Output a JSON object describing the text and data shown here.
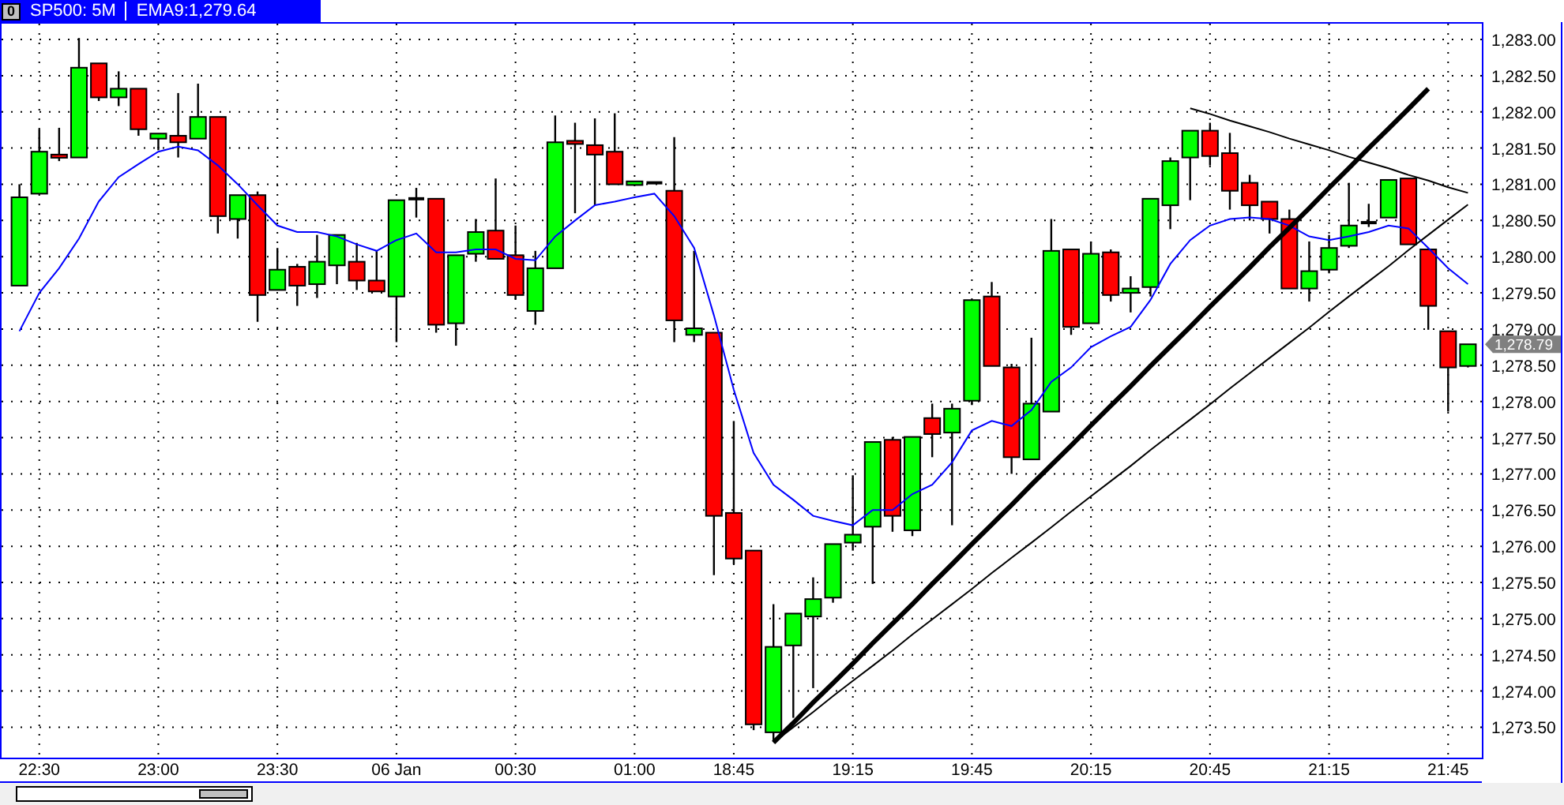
{
  "header": {
    "menu_glyph": "0",
    "symbol": "SP500: 5M",
    "indicator": "EMA9:1,279.64"
  },
  "chart": {
    "last_price_label": "1,278.79",
    "chart_data": {
      "type": "candlestick",
      "grid": true,
      "ylim": [
        1273.08,
        1283.24
      ],
      "categories": [
        null,
        "22:30",
        null,
        null,
        null,
        null,
        null,
        "23:00",
        null,
        null,
        null,
        null,
        null,
        "23:30",
        null,
        null,
        null,
        null,
        null,
        "06 Jan",
        null,
        null,
        null,
        null,
        null,
        "00:30",
        null,
        null,
        null,
        null,
        null,
        "01:00",
        null,
        null,
        null,
        null,
        "18:45",
        null,
        null,
        null,
        null,
        null,
        "19:15",
        null,
        null,
        null,
        null,
        null,
        "19:45",
        null,
        null,
        null,
        null,
        null,
        "20:15",
        null,
        null,
        null,
        null,
        null,
        "20:45",
        null,
        null,
        null,
        null,
        null,
        "21:15",
        null,
        null,
        null,
        null,
        null,
        "21:45",
        null
      ],
      "yticks": [
        {
          "value": 1283,
          "label": "1,283.00"
        },
        {
          "value": 1282.5,
          "label": "1,282.50"
        },
        {
          "value": 1282,
          "label": "1,282.00"
        },
        {
          "value": 1281.5,
          "label": "1,281.50"
        },
        {
          "value": 1281,
          "label": "1,281.00"
        },
        {
          "value": 1280.5,
          "label": "1,280.50"
        },
        {
          "value": 1280,
          "label": "1,280.00"
        },
        {
          "value": 1279.5,
          "label": "1,279.50"
        },
        {
          "value": 1279,
          "label": "1,279.00"
        },
        {
          "value": 1278.5,
          "label": "1,278.50"
        },
        {
          "value": 1278,
          "label": "1,278.00"
        },
        {
          "value": 1277.5,
          "label": "1,277.50"
        },
        {
          "value": 1277,
          "label": "1,277.00"
        },
        {
          "value": 1276.5,
          "label": "1,276.50"
        },
        {
          "value": 1276,
          "label": "1,276.00"
        },
        {
          "value": 1275.5,
          "label": "1,275.50"
        },
        {
          "value": 1275,
          "label": "1,275.00"
        },
        {
          "value": 1274.5,
          "label": "1,274.50"
        },
        {
          "value": 1274,
          "label": "1,274.00"
        },
        {
          "value": 1273.5,
          "label": "1,273.50"
        }
      ],
      "ohlc": [
        [
          1279.6,
          1281.0,
          1279.6,
          1280.82
        ],
        [
          1280.87,
          1281.76,
          1280.87,
          1281.45
        ],
        [
          1281.41,
          1281.78,
          1281.32,
          1281.37
        ],
        [
          1281.37,
          1283.02,
          1281.37,
          1282.61
        ],
        [
          1282.67,
          1282.67,
          1282.15,
          1282.2
        ],
        [
          1282.2,
          1282.56,
          1282.08,
          1282.32
        ],
        [
          1282.32,
          1282.32,
          1281.67,
          1281.76
        ],
        [
          1281.63,
          1281.7,
          1281.47,
          1281.7
        ],
        [
          1281.67,
          1282.26,
          1281.37,
          1281.58
        ],
        [
          1281.63,
          1282.39,
          1281.63,
          1281.93
        ],
        [
          1281.93,
          1281.93,
          1280.32,
          1280.56
        ],
        [
          1280.52,
          1280.85,
          1280.25,
          1280.85
        ],
        [
          1280.85,
          1280.9,
          1279.1,
          1279.47
        ],
        [
          1279.54,
          1280.12,
          1279.54,
          1279.82
        ],
        [
          1279.86,
          1279.9,
          1279.32,
          1279.6
        ],
        [
          1279.62,
          1280.3,
          1279.43,
          1279.93
        ],
        [
          1279.88,
          1280.3,
          1279.62,
          1280.3
        ],
        [
          1279.93,
          1280.19,
          1279.54,
          1279.67
        ],
        [
          1279.67,
          1280.08,
          1279.52,
          1279.52
        ],
        [
          1279.45,
          1280.78,
          1278.82,
          1280.78
        ],
        [
          1280.8,
          1280.95,
          1280.54,
          1280.8
        ],
        [
          1280.8,
          1280.8,
          1278.95,
          1279.06
        ],
        [
          1279.08,
          1280.02,
          1278.77,
          1280.02
        ],
        [
          1280.04,
          1280.52,
          1279.93,
          1280.34
        ],
        [
          1280.36,
          1281.08,
          1279.97,
          1279.97
        ],
        [
          1280.02,
          1280.43,
          1279.41,
          1279.47
        ],
        [
          1279.25,
          1280.08,
          1279.06,
          1279.84
        ],
        [
          1279.84,
          1281.95,
          1279.84,
          1281.58
        ],
        [
          1281.6,
          1281.85,
          1280.6,
          1281.56
        ],
        [
          1281.54,
          1281.91,
          1280.71,
          1281.41
        ],
        [
          1281.45,
          1281.98,
          1281.0,
          1281.0
        ],
        [
          1280.99,
          1281.04,
          1280.99,
          1281.04
        ],
        [
          1281.02,
          1281.02,
          1281.02,
          1281.02
        ],
        [
          1280.91,
          1281.65,
          1278.82,
          1279.12
        ],
        [
          1278.92,
          1280.08,
          1278.82,
          1279.01
        ],
        [
          1278.95,
          1278.95,
          1275.6,
          1276.42
        ],
        [
          1276.46,
          1277.73,
          1275.75,
          1275.83
        ],
        [
          1275.94,
          1275.94,
          1273.46,
          1273.54
        ],
        [
          1273.43,
          1275.2,
          1273.32,
          1274.61
        ],
        [
          1274.63,
          1275.07,
          1273.63,
          1275.07
        ],
        [
          1275.03,
          1275.57,
          1274.04,
          1275.27
        ],
        [
          1275.29,
          1276.03,
          1275.22,
          1276.03
        ],
        [
          1276.05,
          1276.98,
          1275.94,
          1276.16
        ],
        [
          1276.27,
          1277.44,
          1275.48,
          1277.44
        ],
        [
          1277.47,
          1277.51,
          1276.2,
          1276.42
        ],
        [
          1276.22,
          1277.51,
          1276.14,
          1277.51
        ],
        [
          1277.77,
          1277.97,
          1277.23,
          1277.55
        ],
        [
          1277.57,
          1277.97,
          1276.29,
          1277.9
        ],
        [
          1278.01,
          1279.4,
          1277.95,
          1279.4
        ],
        [
          1279.45,
          1279.65,
          1278.49,
          1278.49
        ],
        [
          1278.47,
          1278.52,
          1277.0,
          1277.23
        ],
        [
          1277.2,
          1278.88,
          1277.2,
          1277.97
        ],
        [
          1277.86,
          1280.52,
          1277.86,
          1280.08
        ],
        [
          1280.1,
          1280.1,
          1278.92,
          1279.03
        ],
        [
          1279.08,
          1280.21,
          1279.08,
          1280.04
        ],
        [
          1280.06,
          1280.1,
          1279.38,
          1279.47
        ],
        [
          1279.5,
          1279.73,
          1279.23,
          1279.56
        ],
        [
          1279.58,
          1280.8,
          1279.45,
          1280.8
        ],
        [
          1280.71,
          1281.37,
          1280.38,
          1281.32
        ],
        [
          1281.37,
          1281.74,
          1280.78,
          1281.74
        ],
        [
          1281.74,
          1281.85,
          1281.26,
          1281.39
        ],
        [
          1281.43,
          1281.71,
          1280.65,
          1280.91
        ],
        [
          1281.02,
          1281.13,
          1280.5,
          1280.71
        ],
        [
          1280.76,
          1280.76,
          1280.32,
          1280.52
        ],
        [
          1280.52,
          1280.65,
          1279.56,
          1279.56
        ],
        [
          1279.56,
          1280.21,
          1279.38,
          1279.8
        ],
        [
          1279.82,
          1280.3,
          1279.77,
          1280.12
        ],
        [
          1280.15,
          1281.02,
          1280.12,
          1280.43
        ],
        [
          1280.47,
          1280.73,
          1280.41,
          1280.47
        ],
        [
          1280.54,
          1281.06,
          1280.54,
          1281.06
        ],
        [
          1281.08,
          1281.08,
          1280.17,
          1280.17
        ],
        [
          1280.1,
          1280.1,
          1278.99,
          1279.32
        ],
        [
          1278.97,
          1278.97,
          1277.86,
          1278.47
        ],
        [
          1278.49,
          1278.79,
          1278.47,
          1278.79
        ]
      ],
      "series": [
        {
          "type": "line",
          "color": "#0000ff",
          "values": [
            1278.97,
            1279.5,
            1279.84,
            1280.25,
            1280.76,
            1281.1,
            1281.28,
            1281.45,
            1281.52,
            1281.47,
            1281.26,
            1281.0,
            1280.71,
            1280.43,
            1280.34,
            1280.34,
            1280.28,
            1280.17,
            1280.08,
            1280.23,
            1280.32,
            1280.06,
            1280.06,
            1280.1,
            1280.1,
            1279.97,
            1279.95,
            1280.28,
            1280.5,
            1280.71,
            1280.76,
            1280.82,
            1280.87,
            1280.56,
            1280.12,
            1279.19,
            1278.16,
            1277.29,
            1276.85,
            1276.64,
            1276.42,
            1276.35,
            1276.29,
            1276.5,
            1276.5,
            1276.72,
            1276.85,
            1277.16,
            1277.6,
            1277.73,
            1277.66,
            1277.88,
            1278.27,
            1278.47,
            1278.75,
            1278.9,
            1279.03,
            1279.4,
            1279.9,
            1280.23,
            1280.43,
            1280.52,
            1280.54,
            1280.52,
            1280.43,
            1280.28,
            1280.23,
            1280.28,
            1280.34,
            1280.43,
            1280.39,
            1280.12,
            1279.84,
            1279.62
          ]
        },
        {
          "type": "line",
          "color": "#000000",
          "values": [
            null,
            null,
            null,
            null,
            null,
            null,
            null,
            null,
            null,
            null,
            null,
            null,
            null,
            null,
            null,
            null,
            null,
            null,
            null,
            null,
            null,
            null,
            null,
            null,
            null,
            null,
            null,
            null,
            null,
            null,
            null,
            null,
            null,
            null,
            null,
            null,
            null,
            null,
            1273.29,
            1273.56,
            1273.84,
            1274.11,
            1274.38,
            1274.66,
            1274.93,
            1275.2,
            1275.48,
            1275.75,
            1276.03,
            1276.3,
            1276.57,
            1276.85,
            1277.12,
            1277.39,
            1277.67,
            1277.94,
            1278.21,
            1278.49,
            1278.76,
            1279.03,
            1279.31,
            1279.58,
            1279.85,
            1280.13,
            1280.4,
            1280.67,
            1280.95,
            1281.22,
            1281.5,
            1281.77,
            1282.04,
            1282.32,
            null,
            null
          ]
        },
        {
          "type": "line",
          "color": "#000000",
          "values": [
            null,
            null,
            null,
            null,
            null,
            null,
            null,
            null,
            null,
            null,
            null,
            null,
            null,
            null,
            null,
            null,
            null,
            null,
            null,
            null,
            null,
            null,
            null,
            null,
            null,
            null,
            null,
            null,
            null,
            null,
            null,
            null,
            null,
            null,
            null,
            null,
            null,
            null,
            1273.29,
            1273.5,
            1273.71,
            1273.93,
            1274.14,
            1274.35,
            1274.56,
            1274.78,
            1274.99,
            1275.2,
            1275.41,
            1275.63,
            1275.84,
            1276.05,
            1276.26,
            1276.48,
            1276.69,
            1276.9,
            1277.11,
            1277.33,
            1277.54,
            1277.75,
            1277.96,
            1278.18,
            1278.39,
            1278.6,
            1278.81,
            1279.02,
            1279.24,
            1279.45,
            1279.66,
            1279.87,
            1280.09,
            1280.3,
            1280.51,
            1280.72
          ]
        },
        {
          "type": "line",
          "color": "#000000",
          "values": [
            null,
            null,
            null,
            null,
            null,
            null,
            null,
            null,
            null,
            null,
            null,
            null,
            null,
            null,
            null,
            null,
            null,
            null,
            null,
            null,
            null,
            null,
            null,
            null,
            null,
            null,
            null,
            null,
            null,
            null,
            null,
            null,
            null,
            null,
            null,
            null,
            null,
            null,
            null,
            null,
            null,
            null,
            null,
            null,
            null,
            null,
            null,
            null,
            null,
            null,
            null,
            null,
            null,
            null,
            null,
            null,
            null,
            null,
            null,
            1282.05,
            1281.97,
            1281.88,
            1281.8,
            1281.72,
            1281.63,
            1281.55,
            1281.47,
            1281.38,
            1281.3,
            1281.22,
            1281.13,
            1281.05,
            1280.96,
            1280.88
          ]
        }
      ]
    }
  }
}
